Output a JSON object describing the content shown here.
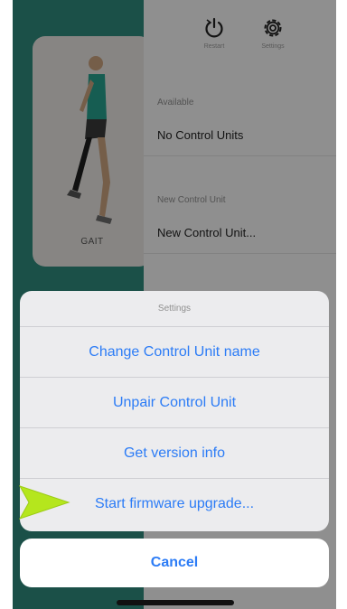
{
  "left": {
    "card_label": "GAIT"
  },
  "header": {
    "restart_label": "Restart",
    "settings_label": "Settings"
  },
  "sections": [
    {
      "header": "Available",
      "value": "No Control Units"
    },
    {
      "header": "New Control Unit",
      "value": "New Control Unit..."
    }
  ],
  "sheet": {
    "title": "Settings",
    "items": [
      "Change Control Unit name",
      "Unpair Control Unit",
      "Get version info",
      "Start firmware upgrade..."
    ],
    "cancel": "Cancel"
  },
  "colors": {
    "accent": "#2c7cf6",
    "teal": "#2f8a7c",
    "pointer": "#b5e61d"
  },
  "icons": {
    "restart": "restart-icon",
    "settings": "gear-icon",
    "pointer": "arrow-pointer-icon"
  }
}
